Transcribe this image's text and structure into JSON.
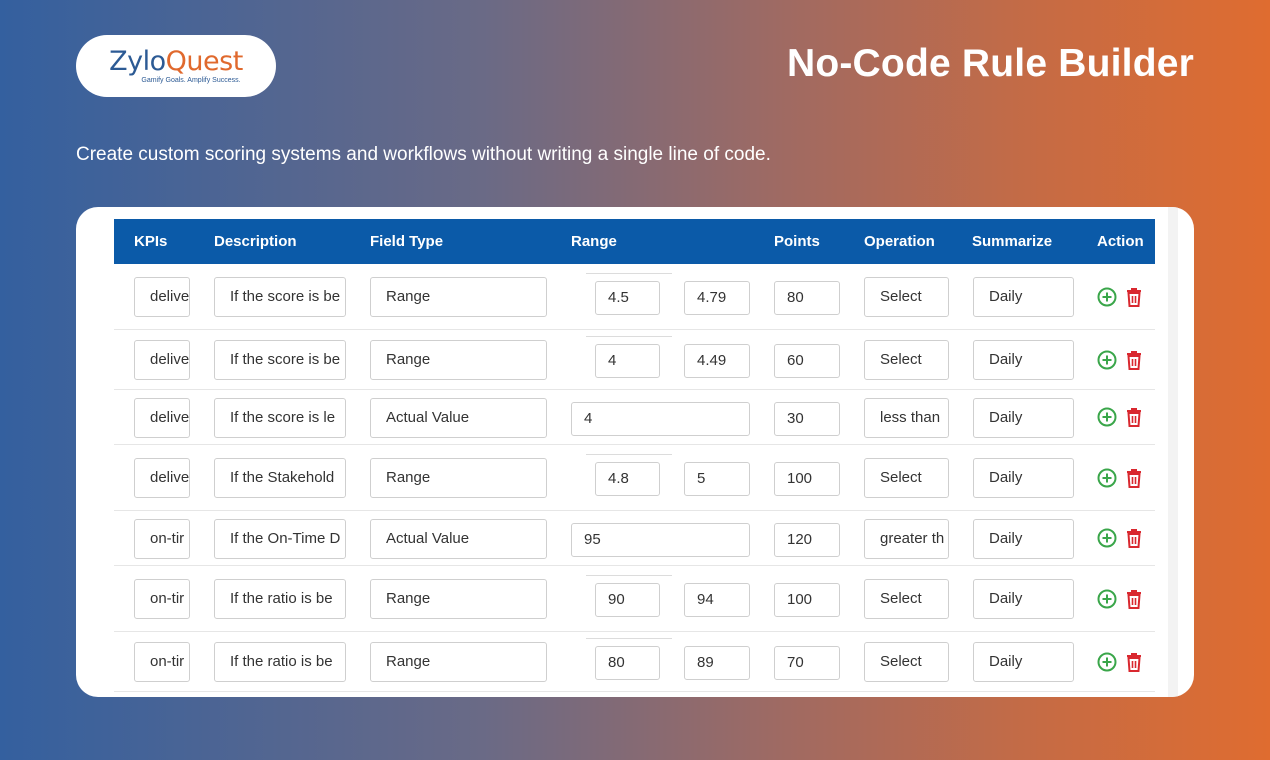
{
  "brand": {
    "name_part1": "Zylo",
    "name_part2": "Quest",
    "tagline": "Gamify Goals. Amplify Success."
  },
  "page_title": "No-Code Rule Builder",
  "subtitle": "Create custom scoring systems and workflows without writing a single line of code.",
  "colors": {
    "header_blue": "#0b5aa8",
    "add_green": "#3aa64a",
    "delete_red": "#d9282f",
    "brand_blue": "#2c5a94",
    "brand_orange": "#e0692d"
  },
  "table": {
    "columns": [
      "KPIs",
      "Description",
      "Field Type",
      "Range",
      "Points",
      "Operation",
      "Summarize",
      "Action"
    ],
    "rows": [
      {
        "kpi": "delive",
        "description": "If the score is be",
        "field_type": "Range",
        "range_min": "4.5",
        "range_max": "4.79",
        "points": "80",
        "operation": "Select",
        "summarize": "Daily"
      },
      {
        "kpi": "delive",
        "description": "If the score is be",
        "field_type": "Range",
        "range_min": "4",
        "range_max": "4.49",
        "points": "60",
        "operation": "Select",
        "summarize": "Daily"
      },
      {
        "kpi": "delive",
        "description": "If the score is le",
        "field_type": "Actual Value",
        "actual_value": "4",
        "points": "30",
        "operation": "less than",
        "summarize": "Daily"
      },
      {
        "kpi": "delive",
        "description": "If the Stakehold",
        "field_type": "Range",
        "range_min": "4.8",
        "range_max": "5",
        "points": "100",
        "operation": "Select",
        "summarize": "Daily"
      },
      {
        "kpi": "on-tir",
        "description": "If the On-Time D",
        "field_type": "Actual Value",
        "actual_value": "95",
        "points": "120",
        "operation": "greater th",
        "summarize": "Daily"
      },
      {
        "kpi": "on-tir",
        "description": "If the ratio is be",
        "field_type": "Range",
        "range_min": "90",
        "range_max": "94",
        "points": "100",
        "operation": "Select",
        "summarize": "Daily"
      },
      {
        "kpi": "on-tir",
        "description": "If the ratio is be",
        "field_type": "Range",
        "range_min": "80",
        "range_max": "89",
        "points": "70",
        "operation": "Select",
        "summarize": "Daily"
      }
    ]
  },
  "icons": {
    "add": "plus-circle-icon",
    "delete": "trash-icon"
  }
}
